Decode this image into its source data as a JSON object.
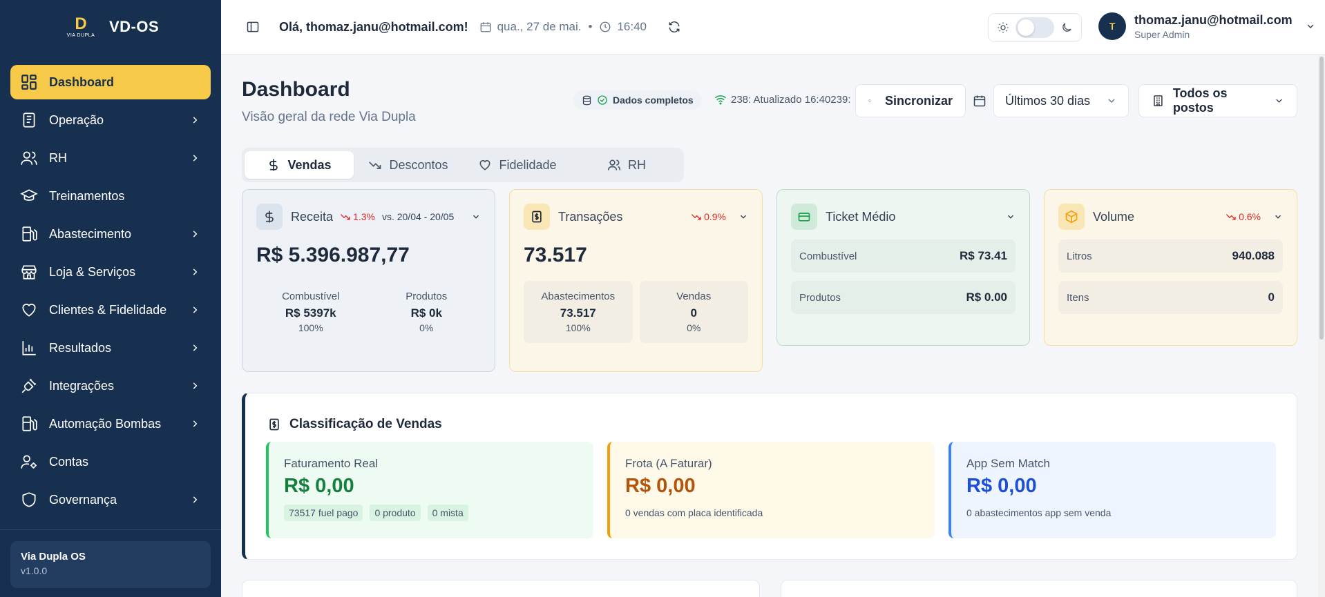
{
  "brand": {
    "name": "VD-OS",
    "logo_mark": "D",
    "logo_sub": "VIA DUPLA"
  },
  "sidebar": {
    "items": [
      {
        "label": "Dashboard",
        "icon": "dashboard-grid-icon",
        "active": true,
        "has_children": false
      },
      {
        "label": "Operação",
        "icon": "clipboard-icon",
        "has_children": true
      },
      {
        "label": "RH",
        "icon": "users-icon",
        "has_children": true
      },
      {
        "label": "Treinamentos",
        "icon": "graduation-cap-icon",
        "has_children": false
      },
      {
        "label": "Abastecimento",
        "icon": "fuel-pump-icon",
        "has_children": true
      },
      {
        "label": "Loja & Serviços",
        "icon": "store-icon",
        "has_children": true
      },
      {
        "label": "Clientes & Fidelidade",
        "icon": "heart-icon",
        "has_children": true
      },
      {
        "label": "Resultados",
        "icon": "bar-chart-icon",
        "has_children": true
      },
      {
        "label": "Integrações",
        "icon": "plug-icon",
        "has_children": true
      },
      {
        "label": "Automação Bombas",
        "icon": "fuel-pump-icon",
        "has_children": true
      },
      {
        "label": "Contas",
        "icon": "user-cog-icon",
        "has_children": false
      },
      {
        "label": "Governança",
        "icon": "shield-icon",
        "has_children": true
      }
    ],
    "footer": {
      "title": "Via Dupla OS",
      "version": "v1.0.0"
    }
  },
  "topbar": {
    "greeting": "Olá, thomaz.janu@hotmail.com!",
    "date": "qua., 27 de mai.",
    "separator": "•",
    "time": "16:40"
  },
  "user": {
    "initial": "T",
    "email": "thomaz.janu@hotmail.com",
    "role": "Super Admin"
  },
  "page": {
    "title": "Dashboard",
    "subtitle": "Visão geral da rede Via Dupla",
    "status": "Dados completos",
    "updated": "238: Atualizado 16:40239:",
    "sync_label": "Sincronizar",
    "period": "Últimos 30 dias",
    "posts": "Todos os postos"
  },
  "tabs": [
    {
      "label": "Vendas",
      "icon": "dollar-icon",
      "active": true
    },
    {
      "label": "Descontos",
      "icon": "trending-down-icon"
    },
    {
      "label": "Fidelidade",
      "icon": "heart-icon"
    },
    {
      "label": "RH",
      "icon": "users-icon"
    }
  ],
  "kpis": {
    "receita": {
      "title": "Receita",
      "delta": "1.3%",
      "range": "vs. 20/04 - 20/05",
      "value": "R$ 5.396.987,77",
      "split": [
        {
          "label": "Combustível",
          "value": "R$ 5397k",
          "pct": "100%"
        },
        {
          "label": "Produtos",
          "value": "R$ 0k",
          "pct": "0%"
        }
      ]
    },
    "transacoes": {
      "title": "Transações",
      "delta": "0.9%",
      "value": "73.517",
      "split": [
        {
          "label": "Abastecimentos",
          "value": "73.517",
          "pct": "100%"
        },
        {
          "label": "Vendas",
          "value": "0",
          "pct": "0%"
        }
      ]
    },
    "ticket": {
      "title": "Ticket Médio",
      "rows": [
        {
          "label": "Combustível",
          "value": "R$ 73.41"
        },
        {
          "label": "Produtos",
          "value": "R$ 0.00"
        }
      ]
    },
    "volume": {
      "title": "Volume",
      "delta": "0.6%",
      "rows": [
        {
          "label": "Litros",
          "value": "940.088"
        },
        {
          "label": "Itens",
          "value": "0"
        }
      ]
    }
  },
  "classification": {
    "title": "Classificação de Vendas",
    "cards": [
      {
        "label": "Faturamento Real",
        "value": "R$ 0,00",
        "chips": [
          "73517 fuel pago",
          "0 produto",
          "0 mista"
        ]
      },
      {
        "label": "Frota (A Faturar)",
        "value": "R$ 0,00",
        "note": "0 vendas com placa identificada"
      },
      {
        "label": "App Sem Match",
        "value": "R$ 0,00",
        "note": "0 abastecimentos app sem venda"
      }
    ]
  },
  "colors": {
    "sidebar_bg": "#17304f",
    "accent": "#f7c948",
    "negative": "#dc2626",
    "green": "#15803d",
    "amber": "#b45309",
    "blue": "#1d4ed8"
  }
}
